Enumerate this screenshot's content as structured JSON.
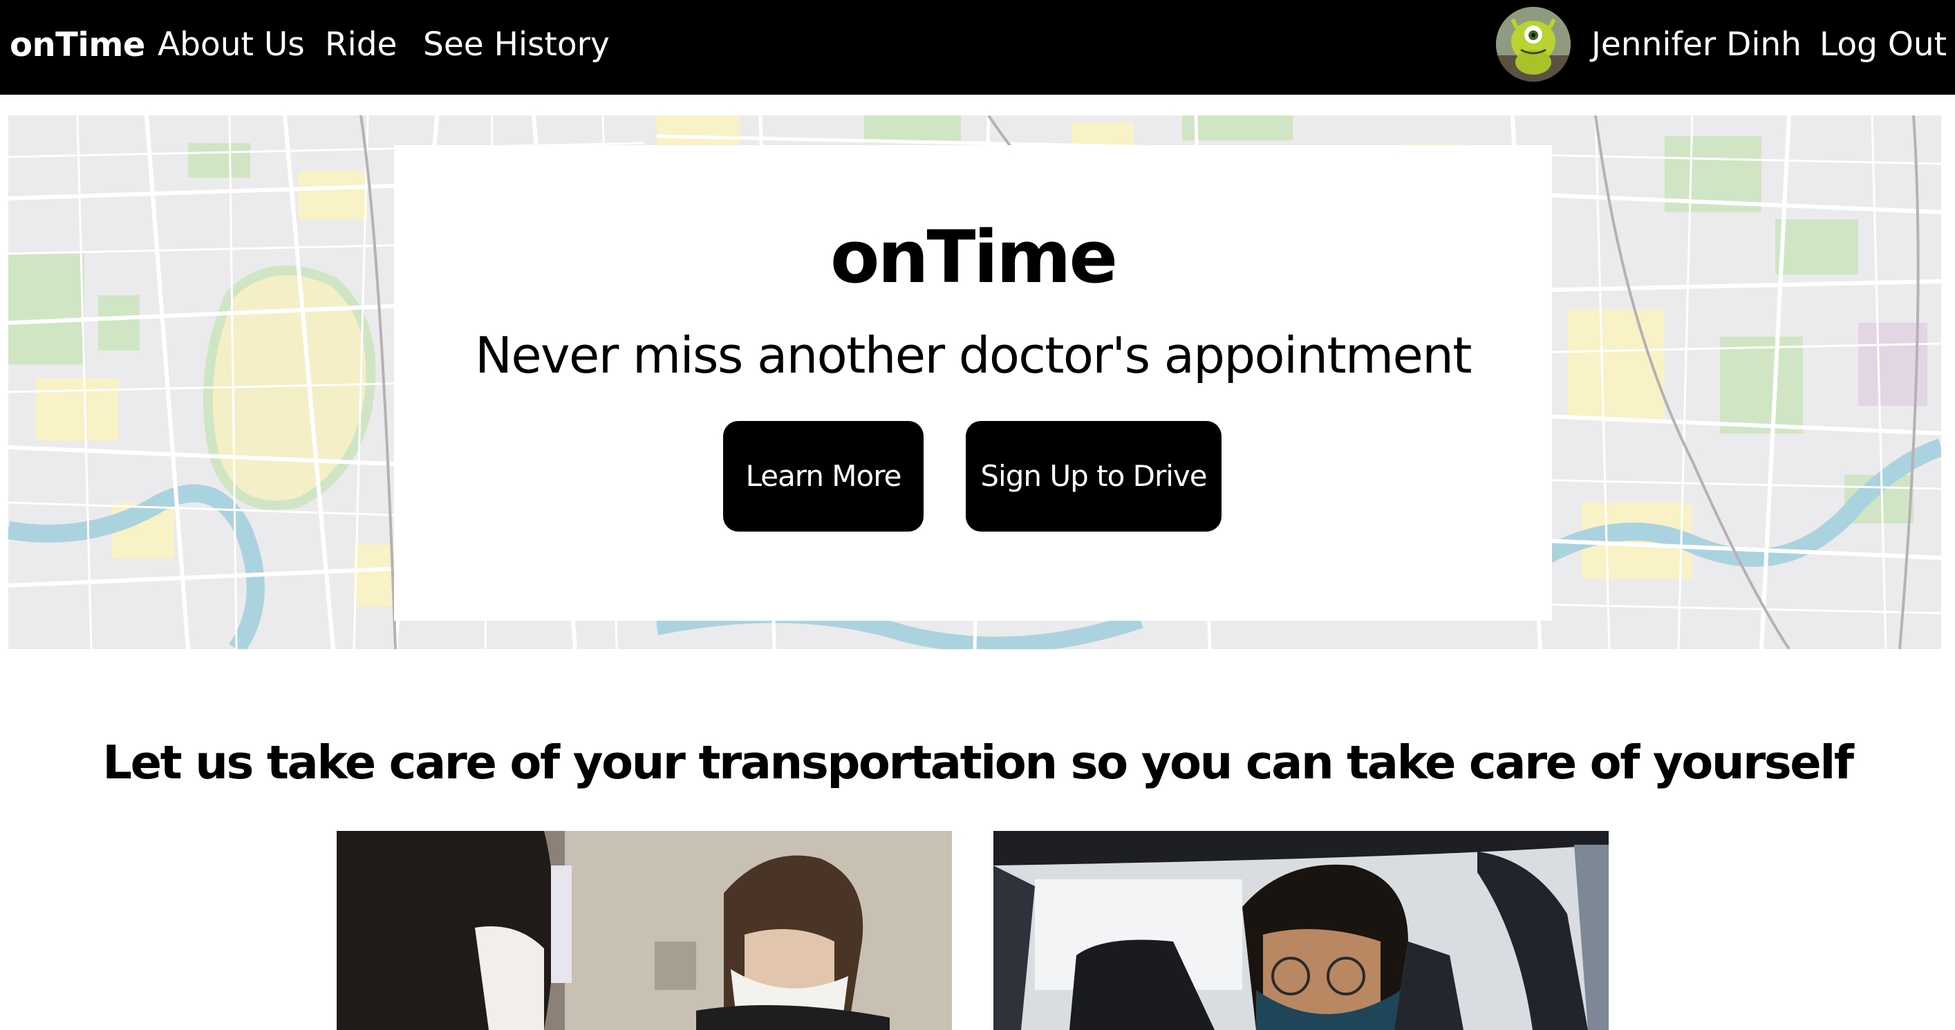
{
  "navbar": {
    "brand": "onTime",
    "links": {
      "about": "About Us",
      "ride": "Ride",
      "history": "See History"
    },
    "user_name": "Jennifer Dinh",
    "logout": "Log Out"
  },
  "hero": {
    "title": "onTime",
    "subtitle": "Never miss another doctor's appointment",
    "learn_more": "Learn More",
    "sign_up_drive": "Sign Up to Drive"
  },
  "tagline": "Let us take care of your transportation so you can take care of yourself",
  "colors": {
    "nav_background": "#000000",
    "button_background": "#000000",
    "map_background": "#ebebed",
    "map_park": "#cfe5c3",
    "map_water": "#aad3df",
    "map_yellow": "#f8f2c6"
  }
}
